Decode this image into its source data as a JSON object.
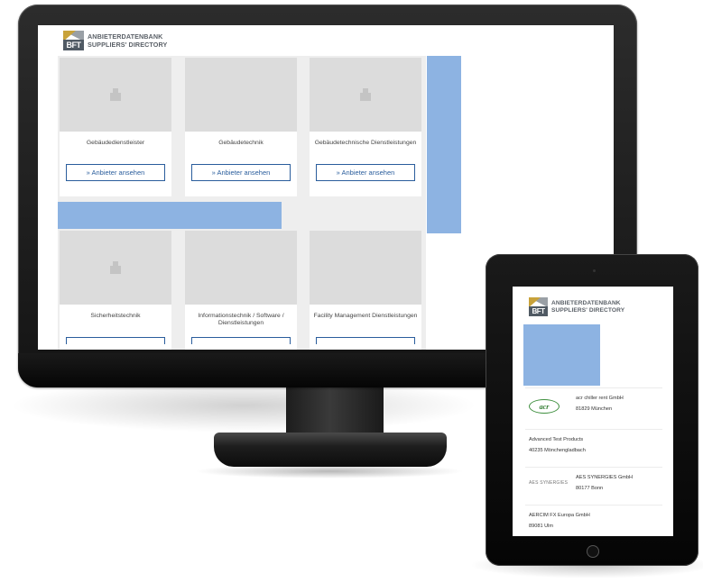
{
  "brand": {
    "logo_text": "BFT",
    "title_line1": "ANBIETERDATENBANK",
    "title_line2": "SUPPLIERS' DIRECTORY"
  },
  "desktop": {
    "cards": [
      {
        "label": "Gebäudedienstleister",
        "button": "» Anbieter ansehen",
        "image": "building-icon"
      },
      {
        "label": "Gebäudetechnik",
        "button": "» Anbieter ansehen",
        "image": "valves-photo"
      },
      {
        "label": "Gebäudetechnische Dienstleistungen",
        "button": "» Anbieter ansehen",
        "image": "building-icon"
      },
      {
        "label": "Sicherheitstechnik",
        "button": "",
        "image": "building-icon"
      },
      {
        "label": "Informationstechnik / Software / Dienstleistungen",
        "button": "",
        "image": "connectors-photo"
      },
      {
        "label": "Facility Management Dienstleistungen",
        "button": "",
        "image": "glass-facade-photo"
      }
    ]
  },
  "tablet": {
    "suppliers": [
      {
        "name": "acr chiller rent GmbH",
        "city": "81829 München",
        "logo": "acr"
      },
      {
        "name": "Advanced Test Products",
        "city": "40235 Mönchengladbach",
        "logo": ""
      },
      {
        "name": "AES SYNERGIES GmbH",
        "city": "80177 Bonn",
        "logo": "AES SYNERGIES"
      },
      {
        "name": "AERCIM FX Europa GmbH",
        "city": "89081 Ulm",
        "logo": ""
      }
    ]
  },
  "colors": {
    "accent_blue": "#8db3e2",
    "button_blue": "#2a5d9c",
    "placeholder_gray": "#dcdcdc"
  }
}
